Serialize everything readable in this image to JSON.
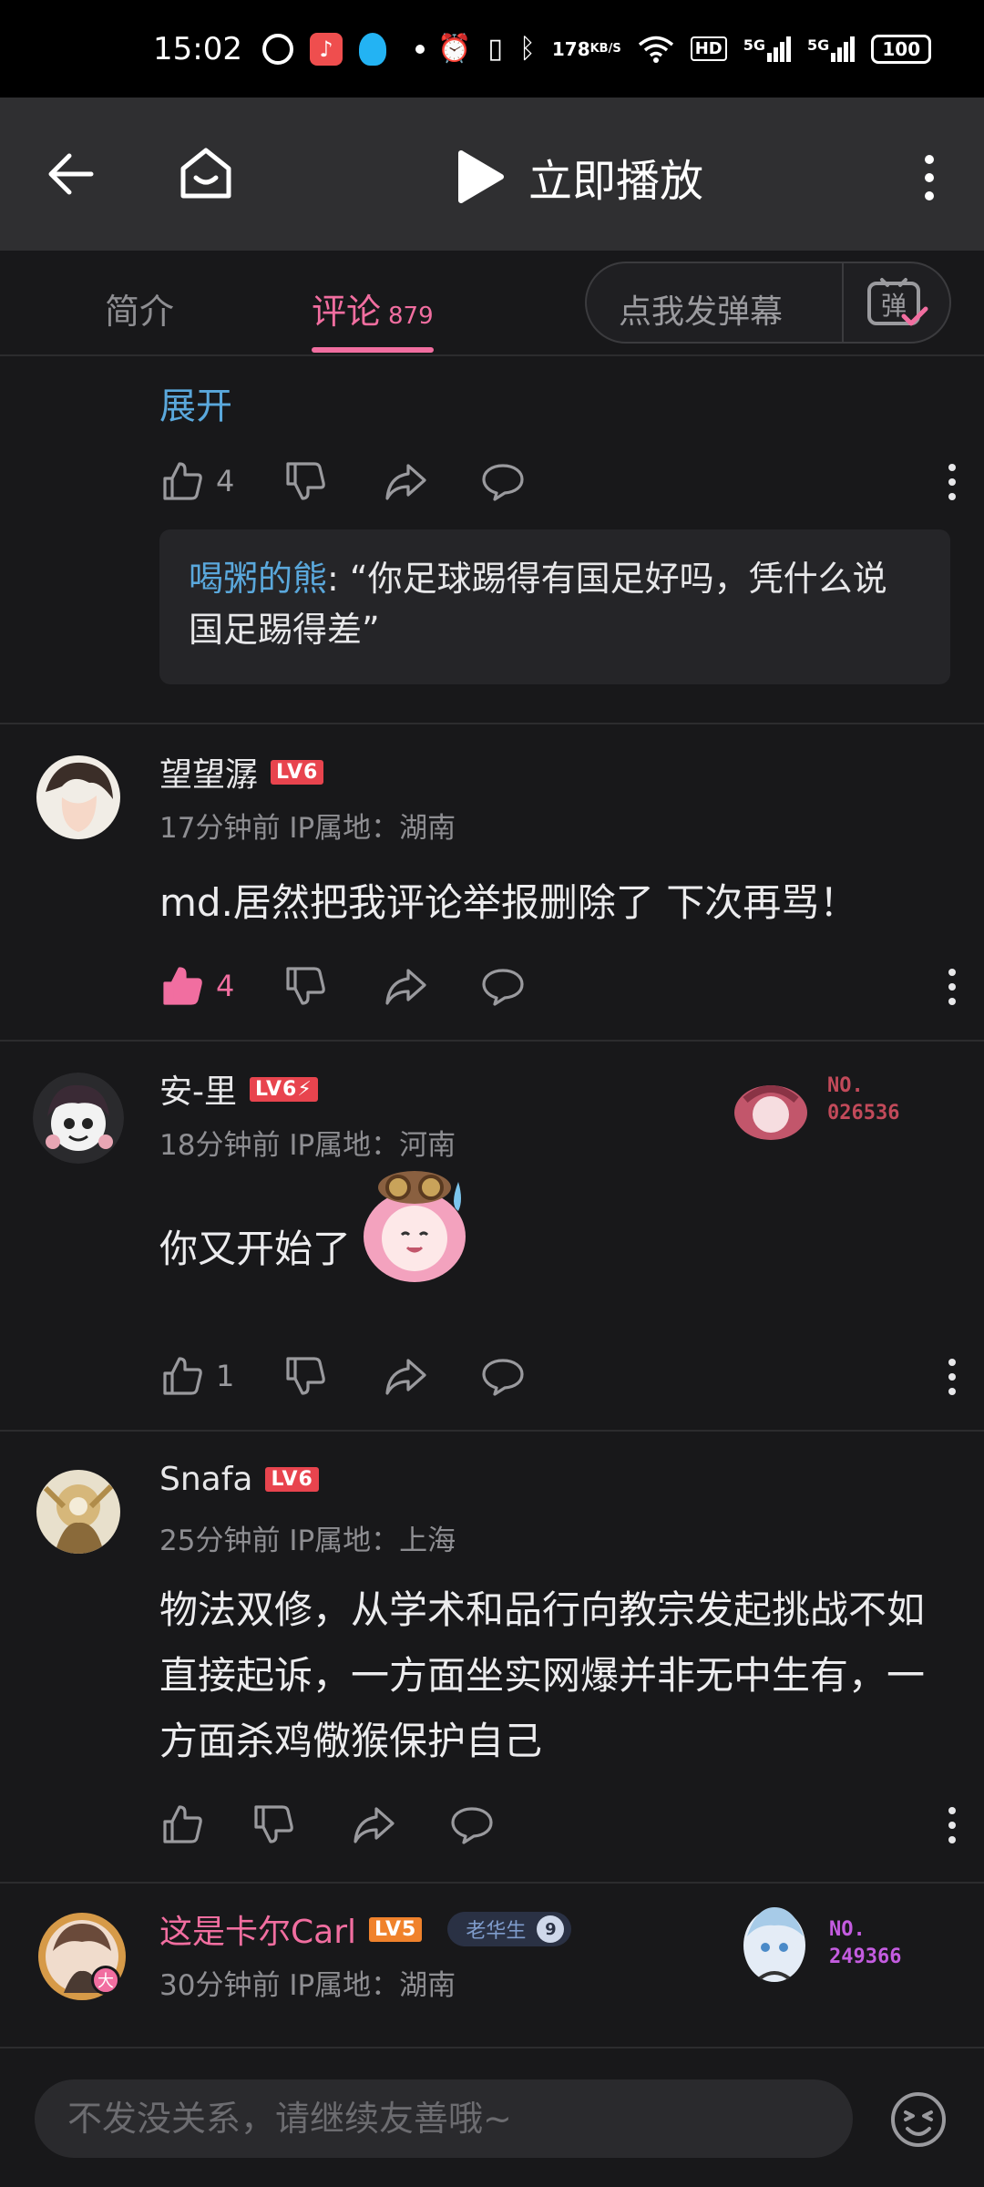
{
  "status_bar": {
    "time": "15:02",
    "net_speed_value": "178",
    "net_speed_unit": "KB/S",
    "hd_label": "HD",
    "sim1": "5G",
    "sim2": "5G",
    "battery": "100"
  },
  "nav": {
    "title": "立即播放"
  },
  "tabs": {
    "intro": "简介",
    "comments": "评论",
    "comments_count": "879",
    "danmaku_placeholder": "点我发弹幕",
    "danmaku_icon_char": "弹"
  },
  "thread": {
    "expand": "展开",
    "likes": "4",
    "reply_user": "喝粥的熊",
    "reply_text": ": “你足球踢得有国足好吗，凭什么说国足踢得差”"
  },
  "comments": [
    {
      "user": "望望潺",
      "level": "LV6",
      "time": "17分钟前",
      "ip": "IP属地：湖南",
      "text": "md.居然把我评论举报删除了 下次再骂！",
      "likes": "4"
    },
    {
      "user": "安-里",
      "level": "LV6⚡",
      "time": "18分钟前",
      "ip": "IP属地：河南",
      "text": "你又开始了",
      "likes": "1",
      "fan_no_label": "NO.",
      "fan_no": "026536"
    },
    {
      "user": "Snafa",
      "level": "LV6",
      "time": "25分钟前",
      "ip": "IP属地：上海",
      "text": "物法双修，从学术和品行向教宗发起挑战不如直接起诉，一方面坐实网爆并非无中生有，一方面杀鸡儆猴保护自己"
    },
    {
      "user": "这是卡尔Carl",
      "level": "LV5",
      "badge": "老华生",
      "badge_num": "9",
      "avatar_tag": "大",
      "time": "30分钟前",
      "ip": "IP属地：湖南",
      "fan_no_label": "NO.",
      "fan_no": "249366"
    }
  ],
  "input": {
    "placeholder": "不发没关系，请继续友善哦~"
  },
  "colors": {
    "accent_pink": "#f16ea0",
    "link_blue": "#5aa8dc",
    "level_red": "#e8444e",
    "level_orange": "#f0822c",
    "background": "#18181a"
  }
}
